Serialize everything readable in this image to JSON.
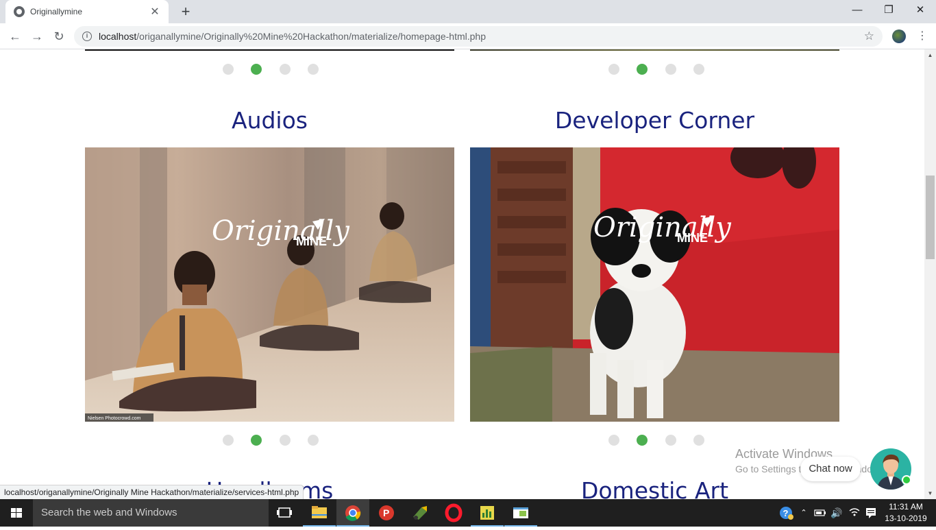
{
  "browser": {
    "tab_title": "Originallymine",
    "tab_close": "✕",
    "new_tab": "+",
    "window_controls": {
      "minimize": "—",
      "restore": "❐",
      "close": "✕"
    },
    "nav": {
      "back": "←",
      "forward": "→",
      "reload": "↻"
    },
    "url_host": "localhost",
    "url_path": "/origanallymine/Originally%20Mine%20Hackathon/materialize/homepage-html.php",
    "star": "☆",
    "menu": "⋮",
    "status_url": "localhost/origanallymine/Originally Mine Hackathon/materialize/services-html.php"
  },
  "page": {
    "sections": [
      {
        "title": "Audios",
        "active_dot": 1,
        "dot_count": 4
      },
      {
        "title": "Developer Corner",
        "active_dot": 1,
        "dot_count": 4
      },
      {
        "title": "Handlooms"
      },
      {
        "title": "Domestic Art"
      }
    ],
    "top_carousels": {
      "active_dot": 1,
      "dot_count": 4
    },
    "watermark_script": "Originally",
    "watermark_caps": "MINE",
    "photo_credit": "Nielsen Photocrowd.com"
  },
  "overlays": {
    "activate_line1": "Activate Windows",
    "activate_line2": "Go to Settings to activate Windows.",
    "chat_label": "Chat now"
  },
  "taskbar": {
    "search_placeholder": "Search the web and Windows",
    "time": "11:31 AM",
    "date": "13-10-2019",
    "apps": [
      "task-view",
      "file-explorer",
      "chrome",
      "app-p",
      "app-marker",
      "opera",
      "app-chart",
      "app-window"
    ]
  },
  "colors": {
    "accent_green": "#4caf50",
    "title_blue": "#1a237e",
    "dot_grey": "#e0e0e0"
  }
}
